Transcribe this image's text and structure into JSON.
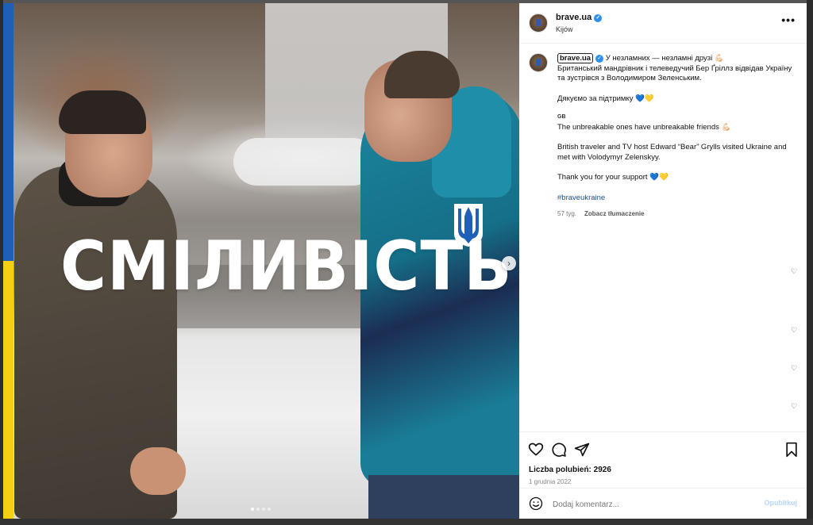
{
  "post": {
    "headline": "СМІЛИВІСТЬ",
    "carousel": {
      "slide_count": 4,
      "active_slide": 1
    },
    "flag_colors": {
      "blue": "#1e5fb8",
      "yellow": "#f5cf12"
    }
  },
  "header": {
    "username": "brave.ua",
    "location": "Kijów",
    "more_icon": "•••"
  },
  "caption": {
    "username": "brave.ua",
    "line1": "У незламних — незламні друзі 💪🏻",
    "paragraph_ua": "Британський мандрівник і телеведучий Бер Ґріллз відвідав Україну та зустрівся з Володимиром Зеленським.",
    "thanks_ua": "Дякуємо за підтримку 💙💛",
    "gb_label": "GB",
    "line_en": "The unbreakable ones have unbreakable friends 💪🏻",
    "paragraph_en": "British traveler and TV host Edward “Bear” Grylls visited Ukraine and met with Volodymyr Zelenskyy.",
    "thanks_en": "Thank you for your support 💙💛",
    "hashtag": "#braveukraine",
    "time_ago": "57 tyg.",
    "translate": "Zobacz tłumaczenie"
  },
  "actions": {
    "likes": "Liczba polubień: 2926",
    "date": "1 grudnia 2022",
    "icons": [
      "heart-icon",
      "comment-icon",
      "share-icon",
      "bookmark-icon"
    ]
  },
  "comment": {
    "placeholder": "Dodaj komentarz...",
    "publish_label": "Opublikuj"
  },
  "colors": {
    "link": "#1d4f8c",
    "verified": "#2d8ff0",
    "publish_disabled": "#b8d6f6"
  }
}
